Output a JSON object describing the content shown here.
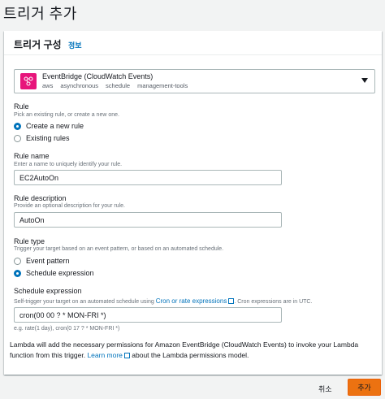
{
  "page": {
    "title": "트리거 추가"
  },
  "panel": {
    "title": "트리거 구성",
    "info": "정보"
  },
  "source": {
    "name": "EventBridge (CloudWatch Events)",
    "tags": [
      "aws",
      "asynchronous",
      "schedule",
      "management-tools"
    ],
    "icon": "eventbridge-icon"
  },
  "rule": {
    "label": "Rule",
    "description": "Pick an existing rule, or create a new one.",
    "options": [
      "Create a new rule",
      "Existing rules"
    ],
    "selected": "Create a new rule"
  },
  "rule_name": {
    "label": "Rule name",
    "description": "Enter a name to uniquely identify your rule.",
    "value": "EC2AutoOn"
  },
  "rule_description": {
    "label": "Rule description",
    "description": "Provide an optional description for your rule.",
    "value": "AutoOn"
  },
  "rule_type": {
    "label": "Rule type",
    "description": "Trigger your target based on an event pattern, or based on an automated schedule.",
    "options": [
      "Event pattern",
      "Schedule expression"
    ],
    "selected": "Schedule expression"
  },
  "schedule": {
    "label": "Schedule expression",
    "description_prefix": "Self-trigger your target on an automated schedule using ",
    "description_link": "Cron or rate expressions",
    "description_suffix": ". Cron expressions are in UTC.",
    "value": "cron(00 00 ? * MON-FRI *)",
    "hint": "e.g. rate(1 day), cron(0 17 ? * MON-FRI *)"
  },
  "permissions_note": {
    "prefix": "Lambda will add the necessary permissions for Amazon EventBridge (CloudWatch Events) to invoke your Lambda function from this trigger. ",
    "link": "Learn more",
    "suffix": " about the Lambda permissions model."
  },
  "footer": {
    "cancel": "취소",
    "add": "추가"
  },
  "colors": {
    "accent": "#0073bb",
    "primary_button": "#ec7211",
    "eventbridge": "#e7157b"
  }
}
